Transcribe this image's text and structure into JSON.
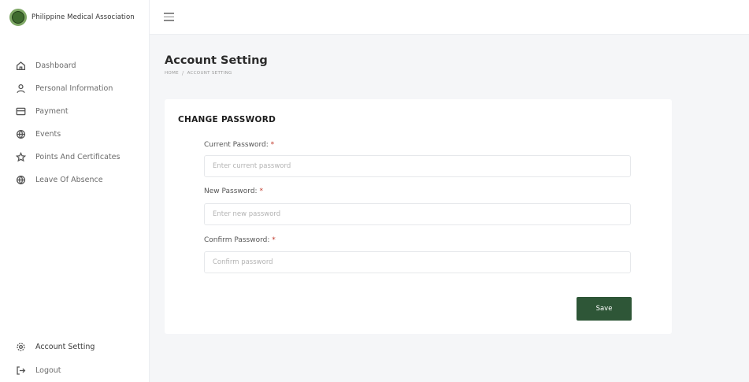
{
  "brand": {
    "name": "Philippine Medical Association"
  },
  "sidebar": {
    "items": [
      {
        "label": "Dashboard",
        "icon": "home-icon"
      },
      {
        "label": "Personal Information",
        "icon": "user-icon"
      },
      {
        "label": "Payment",
        "icon": "card-icon"
      },
      {
        "label": "Events",
        "icon": "globe-icon"
      },
      {
        "label": "Points And Certificates",
        "icon": "star-icon"
      },
      {
        "label": "Leave Of Absence",
        "icon": "globe-icon"
      }
    ],
    "bottom": [
      {
        "label": "Account Setting",
        "icon": "gear-icon"
      },
      {
        "label": "Logout",
        "icon": "logout-icon"
      }
    ]
  },
  "page": {
    "title": "Account Setting",
    "breadcrumb": [
      "Home",
      "Account Setting"
    ]
  },
  "form": {
    "title": "CHANGE PASSWORD",
    "current_password": {
      "label": "Current Password: ",
      "required": "*",
      "placeholder": "Enter current password"
    },
    "new_password": {
      "label": "New Password: ",
      "required": "*",
      "placeholder": "Enter new password"
    },
    "confirm_password": {
      "label": "Confirm Password: ",
      "required": "*",
      "placeholder": "Confirm password"
    },
    "save_label": "Save"
  },
  "colors": {
    "accent": "#2e5637",
    "background": "#f5f6f8",
    "sidebar": "#ffffff"
  }
}
